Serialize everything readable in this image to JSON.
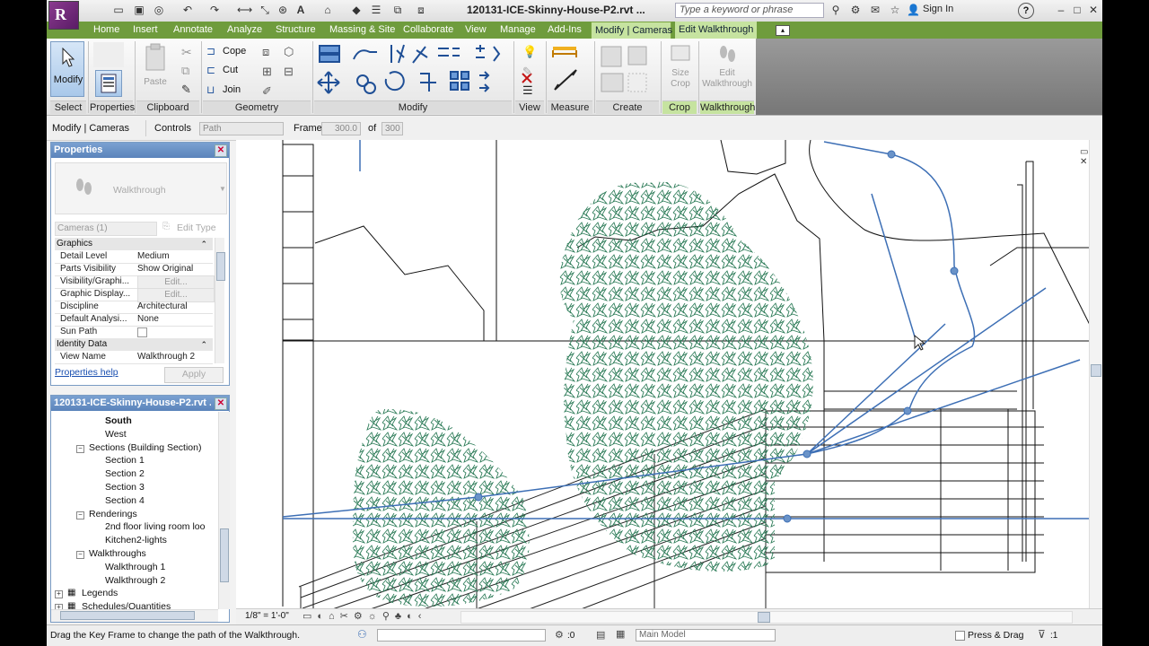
{
  "title_bar": {
    "document_title": "120131-ICE-Skinny-House-P2.rvt ...",
    "search_placeholder": "Type a keyword or phrase",
    "sign_in_label": "Sign In",
    "help_label": "?"
  },
  "tabs": [
    "Home",
    "Insert",
    "Annotate",
    "Analyze",
    "Structure",
    "Massing & Site",
    "Collaborate",
    "View",
    "Manage",
    "Add-Ins",
    "Modify | Cameras",
    "Edit Walkthrough"
  ],
  "ribbon": {
    "modify_label": "Modify",
    "properties_label": "Properties",
    "paste_label": "Paste",
    "cope_label": "Cope",
    "cut_label": "Cut",
    "join_label": "Join",
    "size_crop_label": "Size Crop",
    "edit_walkthrough_label": "Edit Walkthrough",
    "panel_titles": {
      "select": "Select",
      "properties": "Properties",
      "clipboard": "Clipboard",
      "geometry": "Geometry",
      "modify": "Modify",
      "view": "View",
      "measure": "Measure",
      "create": "Create",
      "crop": "Crop",
      "walkthrough": "Walkthrough"
    }
  },
  "options_bar": {
    "context_label": "Modify | Cameras",
    "controls_label": "Controls",
    "controls_value": "Path",
    "frame_label": "Frame",
    "frame_value": "300.0",
    "of_label": "of",
    "frame_total": "300"
  },
  "properties_palette": {
    "title": "Properties",
    "type_name": "Walkthrough",
    "filter_value": "Cameras (1)",
    "edit_type_label": "Edit Type",
    "groups": {
      "graphics": "Graphics",
      "identity": "Identity Data"
    },
    "rows": [
      {
        "key": "Detail Level",
        "value": "Medium"
      },
      {
        "key": "Parts Visibility",
        "value": "Show Original"
      },
      {
        "key": "Visibility/Graphi...",
        "value": "Edit..."
      },
      {
        "key": "Graphic Display...",
        "value": "Edit..."
      },
      {
        "key": "Discipline",
        "value": "Architectural"
      },
      {
        "key": "Default Analysi...",
        "value": "None"
      },
      {
        "key": "Sun Path",
        "value": ""
      }
    ],
    "view_name_key": "View Name",
    "view_name_value": "Walkthrough 2",
    "help_link": "Properties help",
    "apply_label": "Apply"
  },
  "project_browser": {
    "title": "120131-ICE-Skinny-House-P2.rvt ...",
    "nodes": [
      {
        "label": "South",
        "level": 3,
        "bold": true
      },
      {
        "label": "West",
        "level": 3
      },
      {
        "label": "Sections (Building Section)",
        "level": 2,
        "toggle": "−"
      },
      {
        "label": "Section 1",
        "level": 3
      },
      {
        "label": "Section 2",
        "level": 3
      },
      {
        "label": "Section 3",
        "level": 3
      },
      {
        "label": "Section 4",
        "level": 3
      },
      {
        "label": "Renderings",
        "level": 2,
        "toggle": "−"
      },
      {
        "label": "2nd floor living room loo",
        "level": 3
      },
      {
        "label": "Kitchen2-lights",
        "level": 3
      },
      {
        "label": "Walkthroughs",
        "level": 2,
        "toggle": "−"
      },
      {
        "label": "Walkthrough 1",
        "level": 3
      },
      {
        "label": "Walkthrough 2",
        "level": 3
      },
      {
        "label": "Legends",
        "level": 1,
        "toggle": "+"
      },
      {
        "label": "Schedules/Quantities",
        "level": 1,
        "toggle": "+"
      }
    ]
  },
  "view_control_bar": {
    "scale": "1/8\" = 1'-0\""
  },
  "status_bar": {
    "message": "Drag the Key Frame to change the path of the Walkthrough.",
    "worksets_count": ":0",
    "model_value": "Main Model",
    "press_drag_label": "Press & Drag",
    "filter_count": ":1"
  },
  "colors": {
    "ribbon_tab_bar": "#6f9c3d",
    "walkthrough_path": "#3d6fb5",
    "foliage": "#2f7d5a",
    "panel_header": "#6a93c8"
  }
}
